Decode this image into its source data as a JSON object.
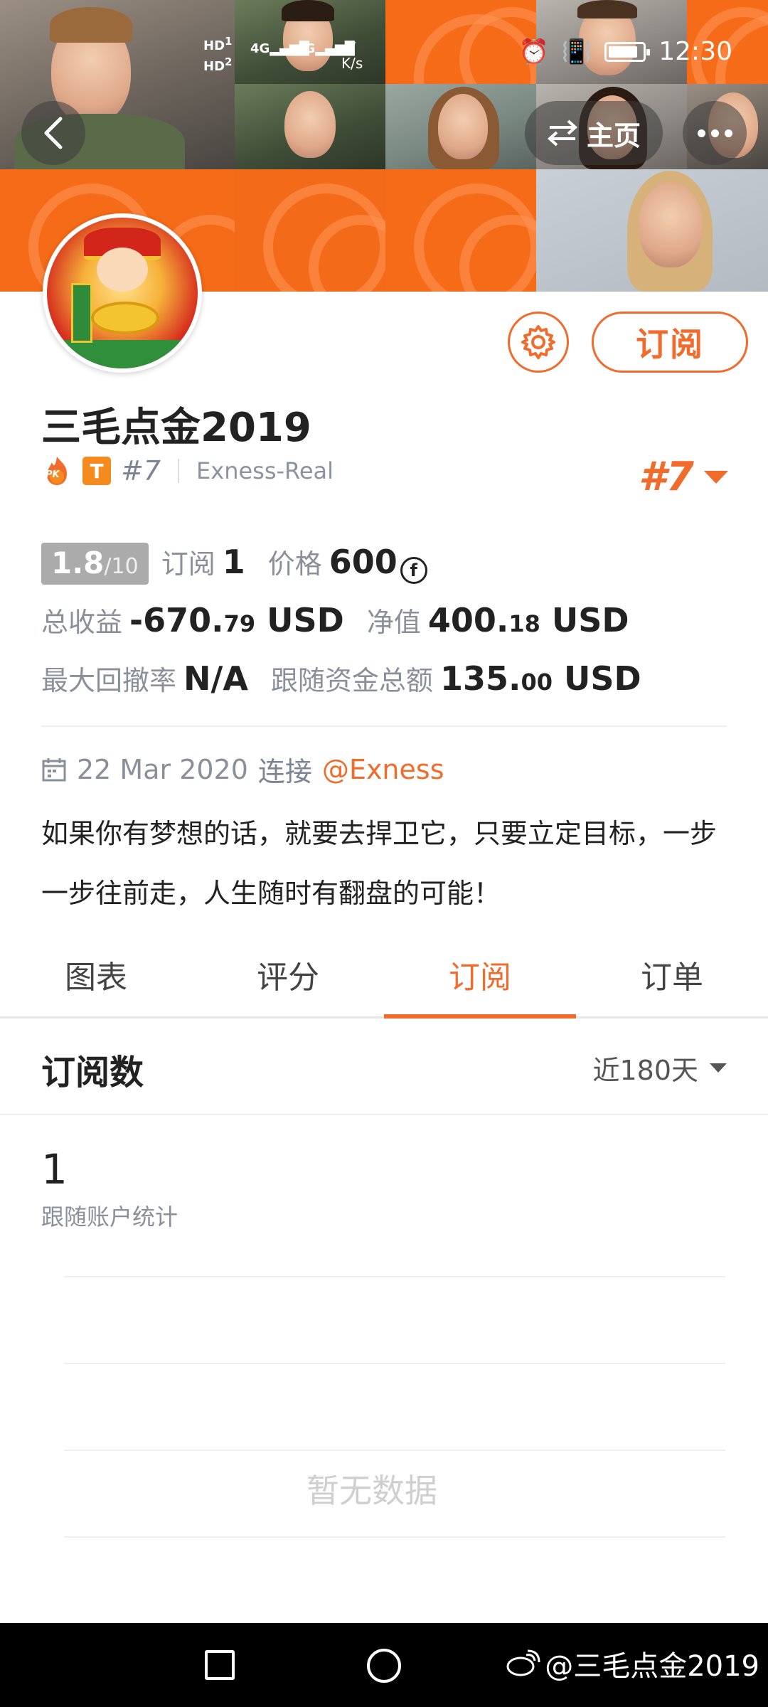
{
  "status_bar": {
    "network_a": "HD",
    "network_a_sub": "1",
    "network_b": "HD",
    "network_b_sub": "2",
    "sig1": "4G",
    "sig2": "4G",
    "speed_value": "7",
    "speed_unit": "K/s",
    "time": "12:30"
  },
  "header": {
    "home_label": "主页"
  },
  "profile": {
    "name": "三毛点金2019",
    "pk_badge": "PK",
    "t_badge": "T",
    "rank_small": "#7",
    "broker": "Exness-Real",
    "rank_big": "#7",
    "subscribe_button": "订阅"
  },
  "stats": {
    "score": "1.8",
    "score_max": "/10",
    "subs_label": "订阅",
    "subs_value": "1",
    "price_label": "价格",
    "price_value": "600",
    "coin_symbol": "f",
    "total_profit_label": "总收益",
    "total_profit_int": "-670.",
    "total_profit_dec": "79",
    "total_profit_unit": "USD",
    "equity_label": "净值",
    "equity_int": "400.",
    "equity_dec": "18",
    "equity_unit": "USD",
    "drawdown_label": "最大回撤率",
    "drawdown_value": "N/A",
    "follow_label": "跟随资金总额",
    "follow_int": "135.",
    "follow_dec": "00",
    "follow_unit": "USD"
  },
  "info": {
    "date": "22 Mar 2020",
    "connect_label": "连接",
    "connect_link": "@Exness",
    "bio": "如果你有梦想的话，就要去捍卫它，只要立定目标，一步一步往前走，人生随时有翻盘的可能！"
  },
  "tabs": [
    {
      "label": "图表"
    },
    {
      "label": "评分"
    },
    {
      "label": "订阅"
    },
    {
      "label": "订单"
    }
  ],
  "active_tab": 2,
  "section": {
    "title": "订阅数",
    "period": "近180天",
    "count": "1",
    "count_label": "跟随账户统计",
    "empty_text": "暂无数据"
  },
  "watermark": {
    "text": "@三毛点金2019"
  },
  "colors": {
    "accent": "#f06b2c",
    "header_orange": "#f56b17"
  }
}
